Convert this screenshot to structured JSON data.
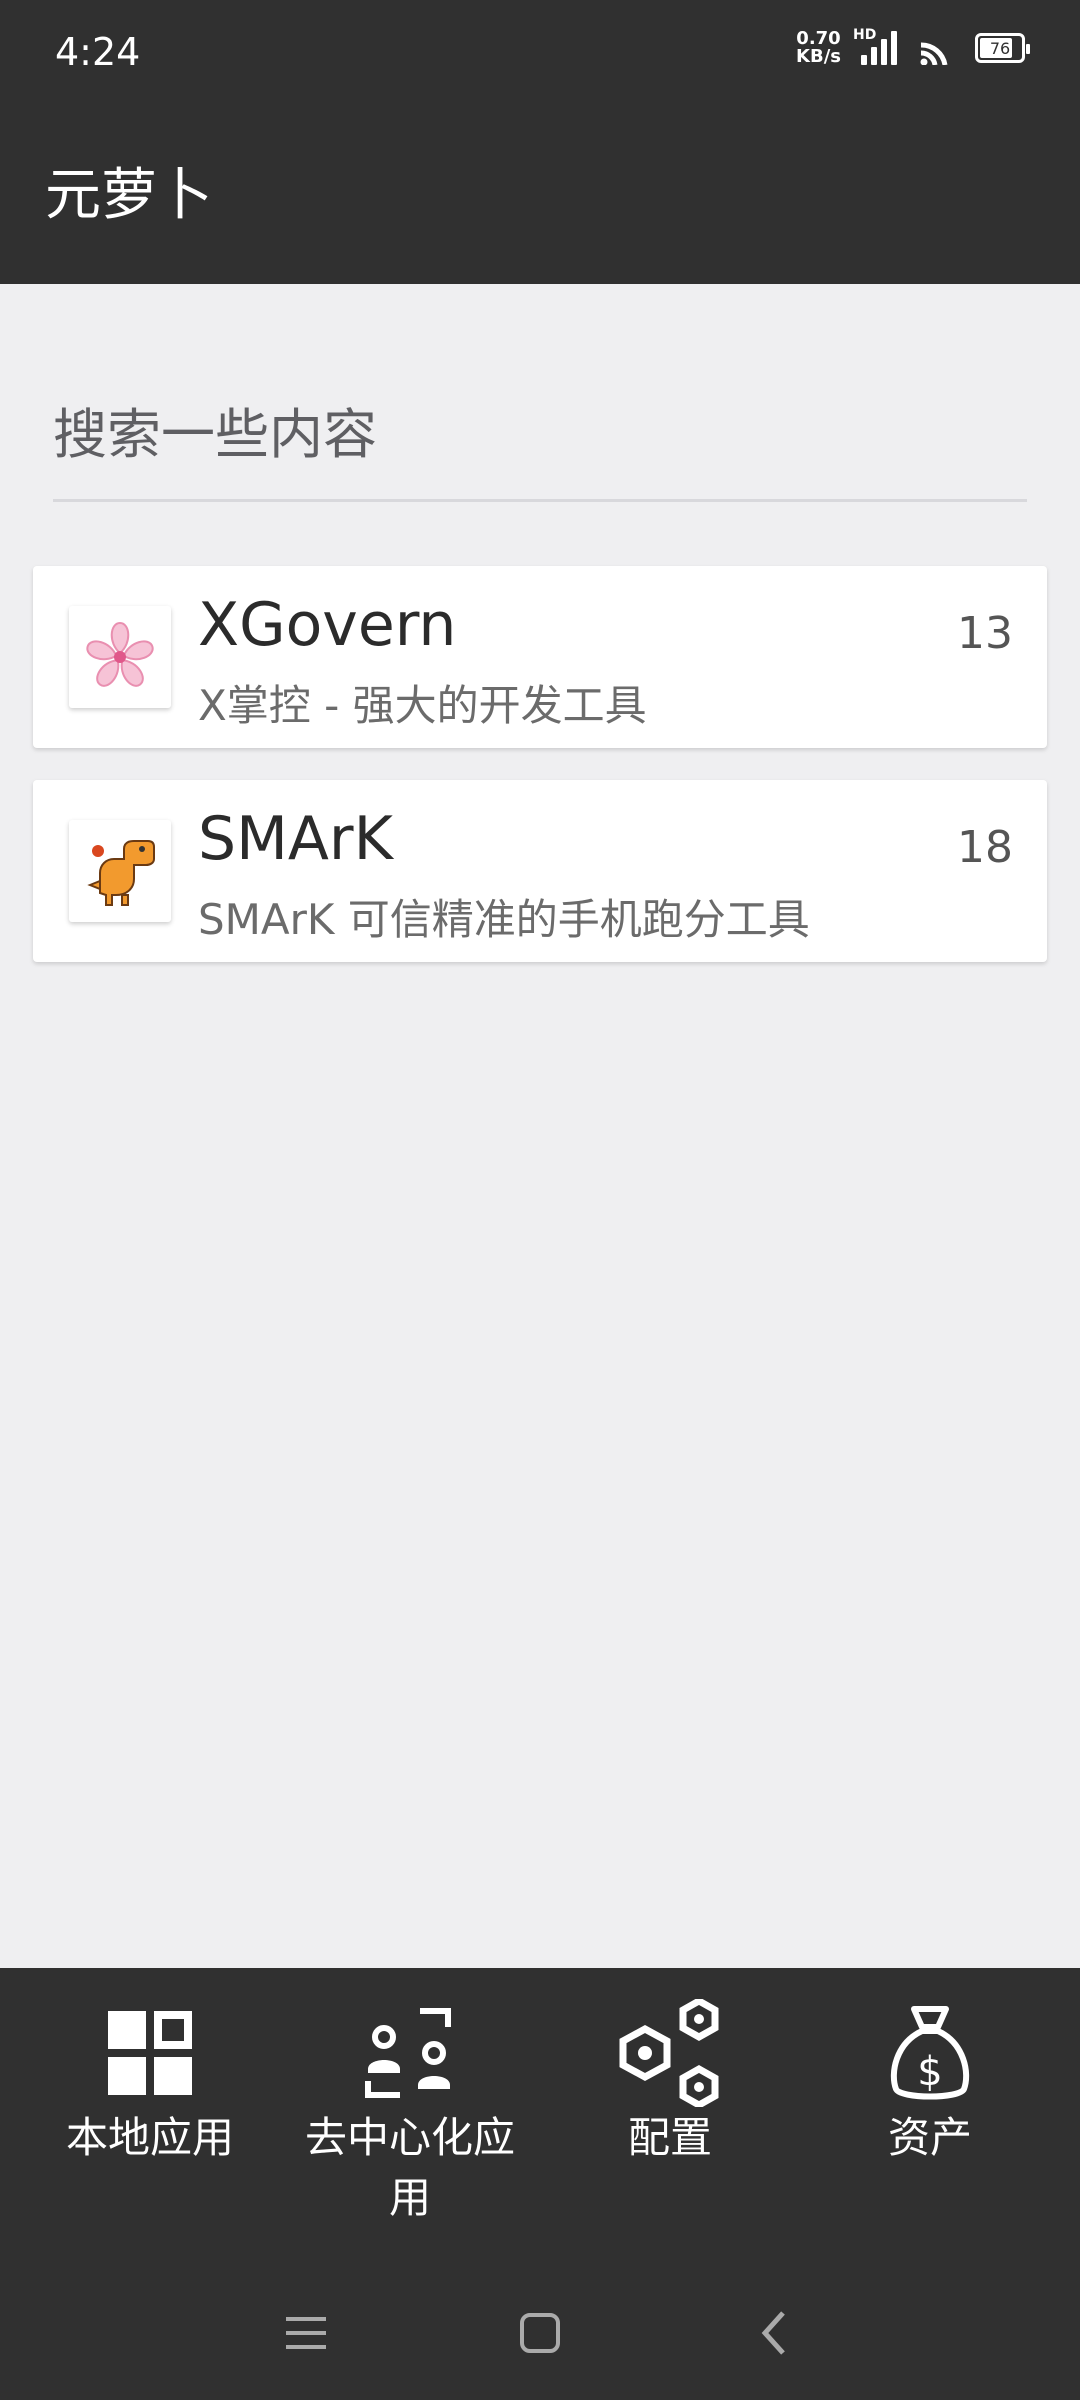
{
  "status": {
    "time": "4:24",
    "net_speed_top": "0.70",
    "net_speed_bottom": "KB/s",
    "signal_label": "HD",
    "battery": "76"
  },
  "app_bar": {
    "title": "元萝卜"
  },
  "search": {
    "placeholder": "搜索一些内容",
    "value": ""
  },
  "apps": [
    {
      "title": "XGovern",
      "subtitle": "X掌控 - 强大的开发工具",
      "count": "13",
      "icon": "sakura-flower-icon"
    },
    {
      "title": "SMArK",
      "subtitle": "SMArK 可信精准的手机跑分工具",
      "count": "18",
      "icon": "dinosaur-icon"
    }
  ],
  "bottom_nav": [
    {
      "label": "本地应用",
      "icon": "grid-icon"
    },
    {
      "label": "去中心化应用",
      "icon": "people-icon"
    },
    {
      "label": "配置",
      "icon": "hexagons-icon"
    },
    {
      "label": "资产",
      "icon": "money-bag-icon"
    }
  ],
  "colors": {
    "bar": "#303030",
    "background": "#efeff1",
    "card": "#ffffff"
  }
}
